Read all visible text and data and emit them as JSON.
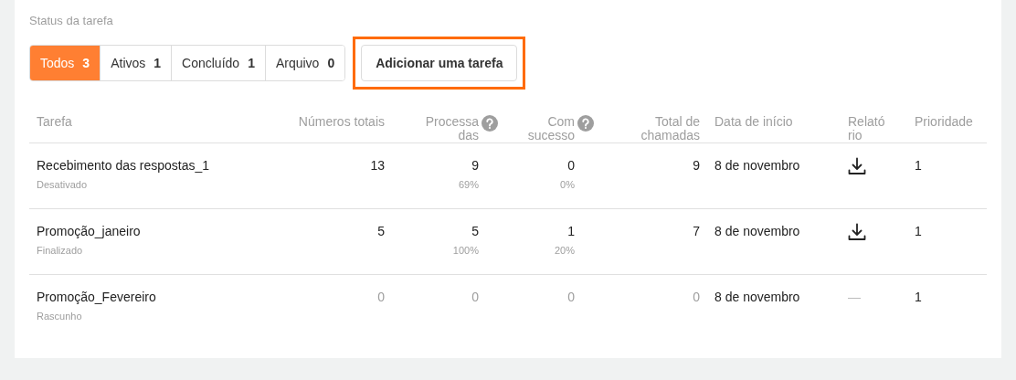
{
  "filter": {
    "label": "Status da tarefa",
    "tabs": [
      {
        "label": "Todos",
        "count": "3",
        "selected": true
      },
      {
        "label": "Ativos",
        "count": "1",
        "selected": false
      },
      {
        "label": "Concluído",
        "count": "1",
        "selected": false
      },
      {
        "label": "Arquivo",
        "count": "0",
        "selected": false
      }
    ]
  },
  "add_button": {
    "label": "Adicionar uma tarefa",
    "highlighted": true
  },
  "table": {
    "columns": [
      {
        "label_lines": [
          "Tarefa"
        ],
        "kind": "text",
        "help": false
      },
      {
        "label_lines": [
          "Números totais"
        ],
        "kind": "number",
        "help": false
      },
      {
        "label_lines": [
          "Processa",
          "das"
        ],
        "kind": "number",
        "help": true
      },
      {
        "label_lines": [
          "Com",
          "sucesso"
        ],
        "kind": "number",
        "help": true
      },
      {
        "label_lines": [
          "Total de",
          "chamadas"
        ],
        "kind": "number",
        "help": false
      },
      {
        "label_lines": [
          "Data de início"
        ],
        "kind": "text",
        "help": false
      },
      {
        "label_lines": [
          "Relató",
          "rio"
        ],
        "kind": "text",
        "help": false
      },
      {
        "label_lines": [
          "Prioridade"
        ],
        "kind": "text",
        "help": false
      }
    ],
    "rows": [
      {
        "name": "Recebimento das respostas_1",
        "status": "Desativado",
        "totals": "13",
        "processed": "9",
        "processed_pct": "69%",
        "success": "0",
        "success_pct": "0%",
        "calls": "9",
        "start": "8 de novembro",
        "report": {
          "kind": "download"
        },
        "priority": "1",
        "draft": false
      },
      {
        "name": "Promoção_janeiro",
        "status": "Finalizado",
        "totals": "5",
        "processed": "5",
        "processed_pct": "100%",
        "success": "1",
        "success_pct": "20%",
        "calls": "7",
        "start": "8 de novembro",
        "report": {
          "kind": "download"
        },
        "priority": "1",
        "draft": false
      },
      {
        "name": "Promoção_Fevereiro",
        "status": "Rascunho",
        "totals": "0",
        "processed": "0",
        "success": "0",
        "calls": "0",
        "start": "8 de novembro",
        "report": {
          "kind": "dash",
          "text": "—"
        },
        "priority": "1",
        "draft": true
      }
    ]
  }
}
